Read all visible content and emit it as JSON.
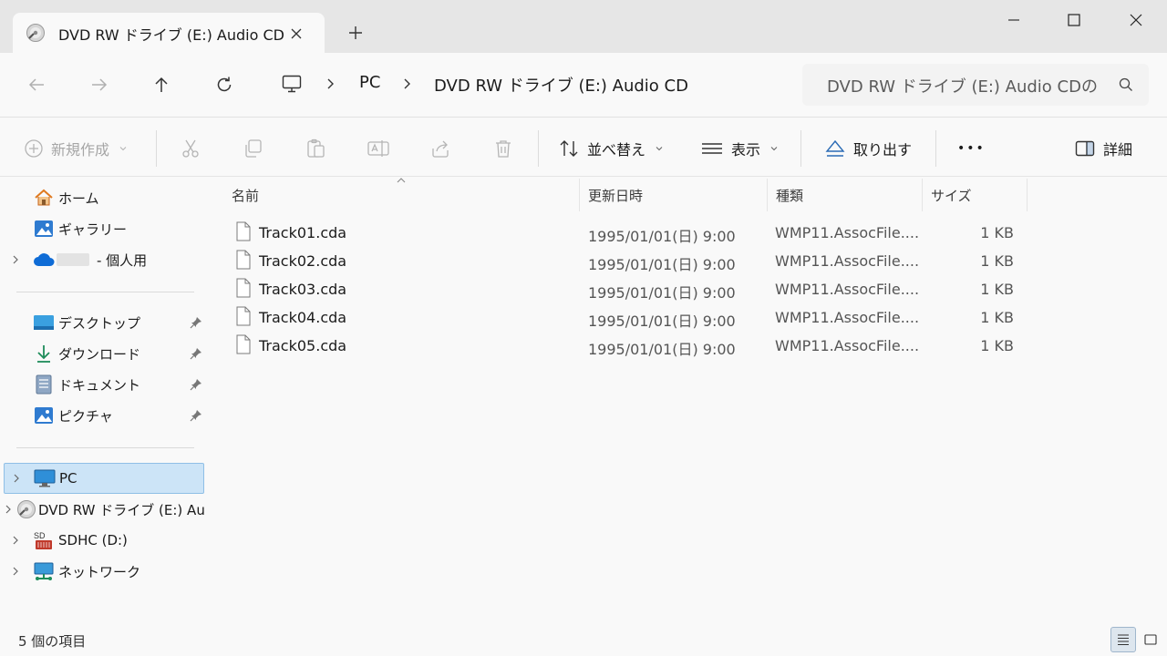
{
  "window": {
    "tab_title": "DVD RW ドライブ (E:) Audio CD",
    "new_tab_symbol": "+",
    "controls": [
      "minimize",
      "maximize",
      "close"
    ]
  },
  "address": {
    "breadcrumbs": [
      "PC",
      "DVD RW ドライブ (E:) Audio CD"
    ],
    "search_placeholder": "DVD RW ドライブ (E:) Audio CDの検索"
  },
  "commands": {
    "new": "新規作成",
    "sort": "並べ替え",
    "view": "表示",
    "eject": "取り出す",
    "more": "•••",
    "details": "詳細"
  },
  "nav": {
    "quick": [
      {
        "label": "ホーム",
        "icon": "home-icon"
      },
      {
        "label": "ギャラリー",
        "icon": "gallery-icon"
      },
      {
        "label": "- 個人用",
        "icon": "onedrive-icon"
      }
    ],
    "pinned": [
      {
        "label": "デスクトップ",
        "icon": "desktop-icon"
      },
      {
        "label": "ダウンロード",
        "icon": "download-icon"
      },
      {
        "label": "ドキュメント",
        "icon": "documents-icon"
      },
      {
        "label": "ピクチャ",
        "icon": "pictures-icon"
      }
    ],
    "devices": [
      {
        "label": "PC",
        "icon": "pc-icon"
      },
      {
        "label": "DVD RW ドライブ (E:) Audio CD",
        "icon": "dvd-icon"
      },
      {
        "label": "SDHC (D:)",
        "icon": "sd-card-icon"
      },
      {
        "label": "ネットワーク",
        "icon": "network-icon"
      }
    ]
  },
  "columns": {
    "name": "名前",
    "date": "更新日時",
    "type": "種類",
    "size": "サイズ"
  },
  "files": [
    {
      "name": "Track01.cda",
      "date": "1995/01/01(日) 9:00",
      "type": "WMP11.AssocFile....",
      "size": "1 KB"
    },
    {
      "name": "Track02.cda",
      "date": "1995/01/01(日) 9:00",
      "type": "WMP11.AssocFile....",
      "size": "1 KB"
    },
    {
      "name": "Track03.cda",
      "date": "1995/01/01(日) 9:00",
      "type": "WMP11.AssocFile....",
      "size": "1 KB"
    },
    {
      "name": "Track04.cda",
      "date": "1995/01/01(日) 9:00",
      "type": "WMP11.AssocFile....",
      "size": "1 KB"
    },
    {
      "name": "Track05.cda",
      "date": "1995/01/01(日) 9:00",
      "type": "WMP11.AssocFile....",
      "size": "1 KB"
    }
  ],
  "status": {
    "item_count": "5 個の項目"
  }
}
